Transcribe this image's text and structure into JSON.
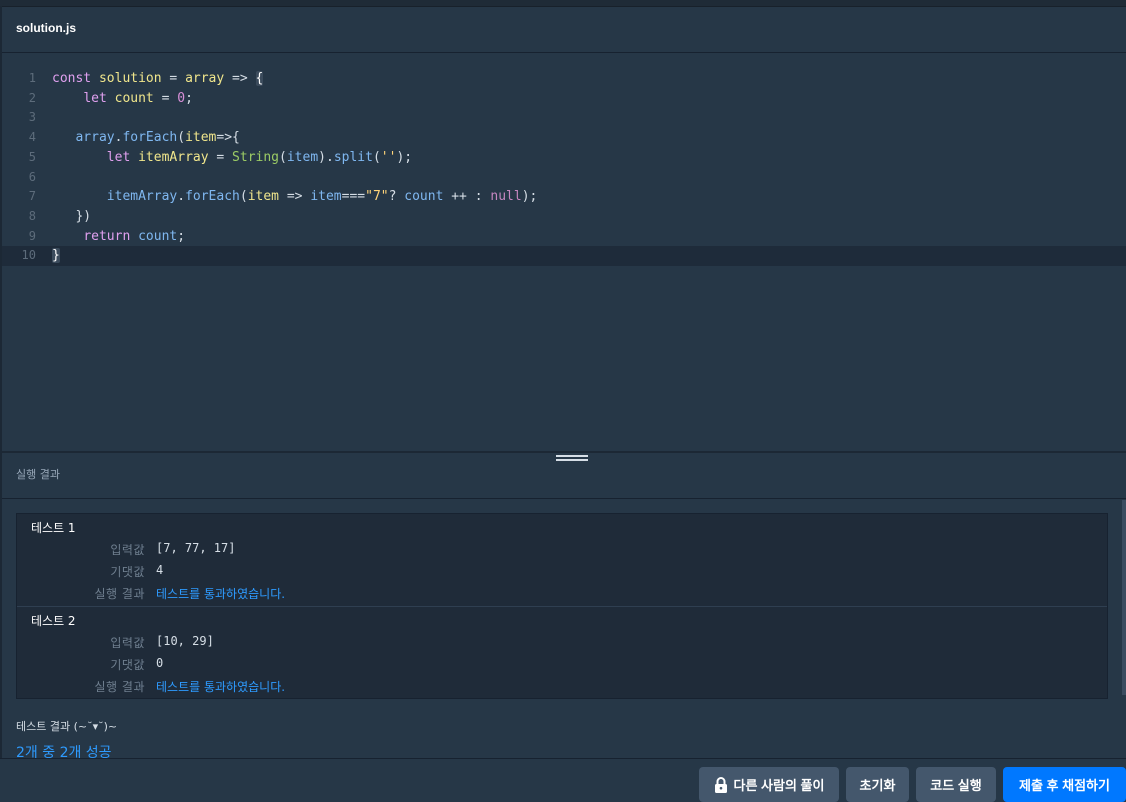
{
  "tab": {
    "title": "solution.js"
  },
  "editor": {
    "lines": [
      {
        "num": "1"
      },
      {
        "num": "2"
      },
      {
        "num": "3"
      },
      {
        "num": "4"
      },
      {
        "num": "5"
      },
      {
        "num": "6"
      },
      {
        "num": "7"
      },
      {
        "num": "8"
      },
      {
        "num": "9"
      },
      {
        "num": "10"
      }
    ]
  },
  "result": {
    "header": "실행 결과",
    "tests": [
      {
        "title": "테스트 1",
        "input_label": "입력값",
        "input": "[7, 77, 17]",
        "expected_label": "기댓값",
        "expected": "4",
        "result_label": "실행 결과",
        "result": "테스트를 통과하였습니다."
      },
      {
        "title": "테스트 2",
        "input_label": "입력값",
        "input": "[10, 29]",
        "expected_label": "기댓값",
        "expected": "0",
        "result_label": "실행 결과",
        "result": "테스트를 통과하였습니다."
      }
    ],
    "summary_label": "테스트 결과 (~˘▾˘)~",
    "summary": "2개 중 2개 성공"
  },
  "buttons": {
    "others": "다른 사람의 풀이",
    "reset": "초기화",
    "run": "코드 실행",
    "submit": "제출 후 채점하기"
  },
  "colors": {
    "accent": "#0078ff",
    "pass": "#2e9bff",
    "bg": "#263747"
  }
}
